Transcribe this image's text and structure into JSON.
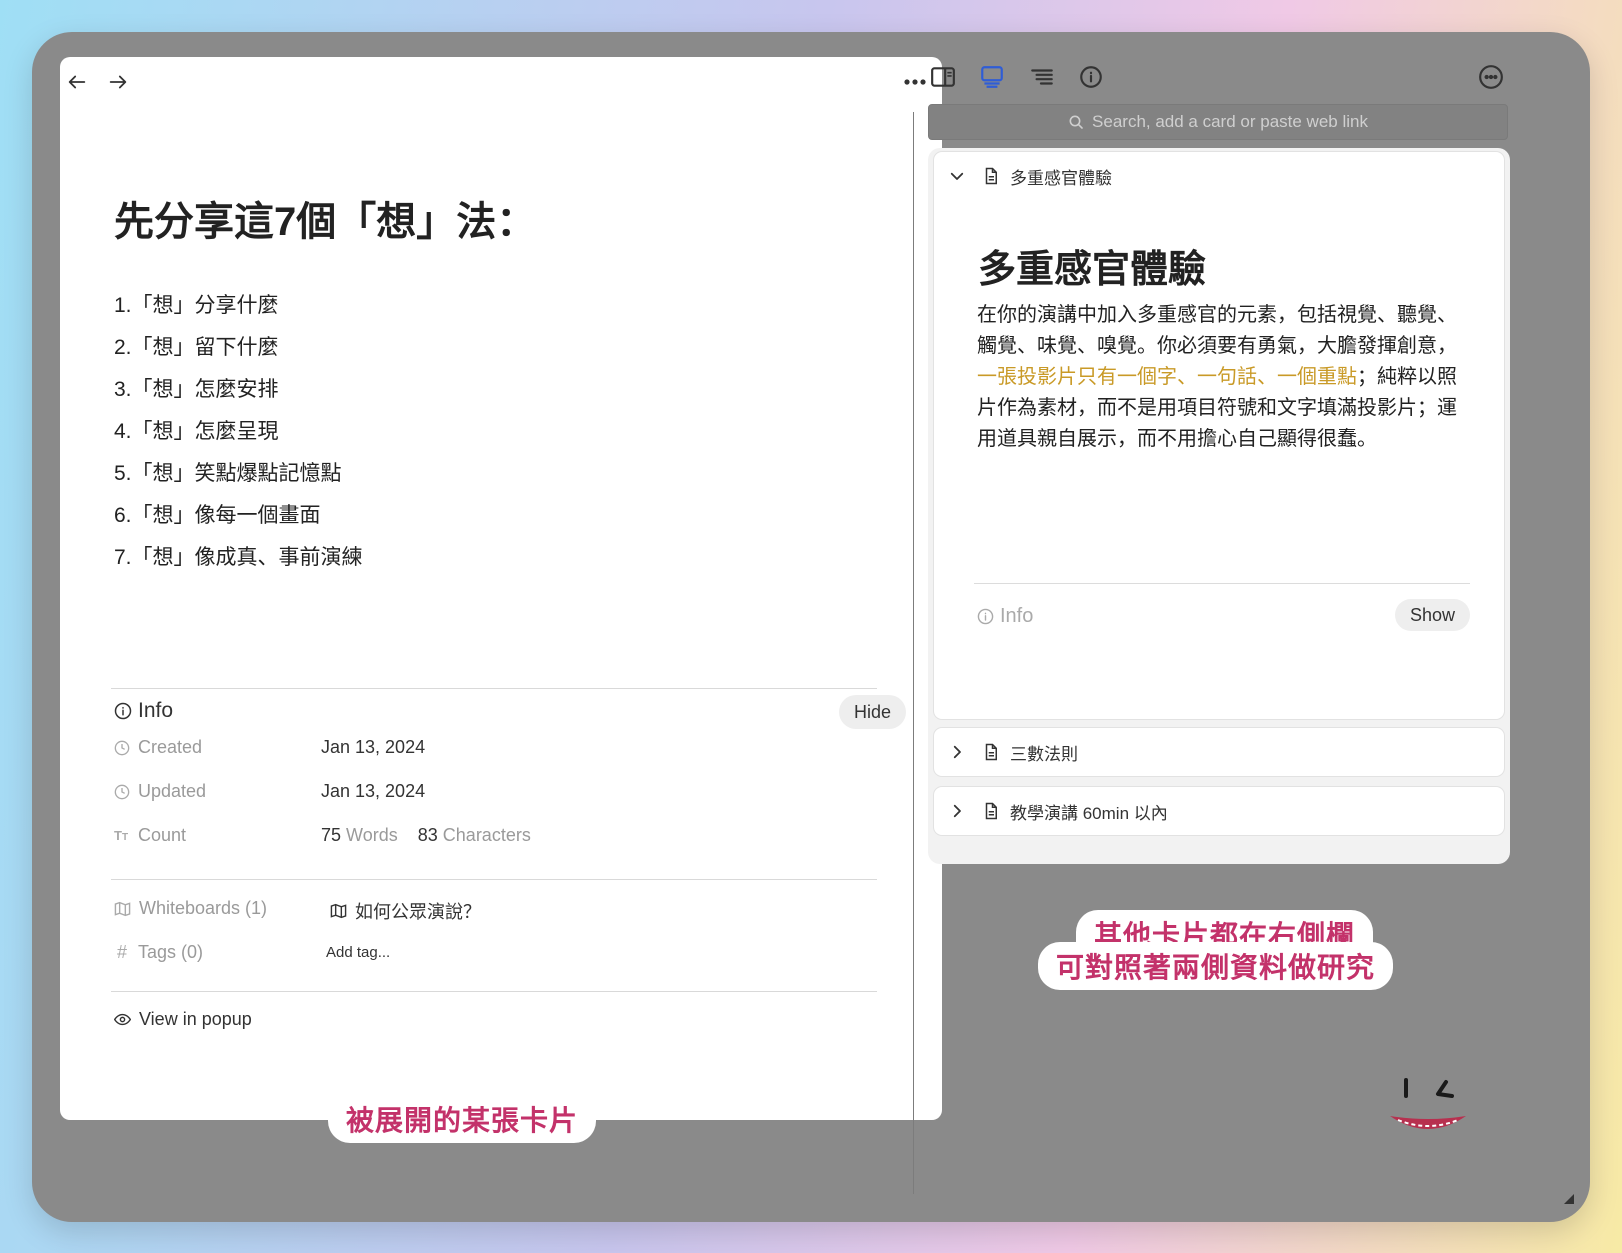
{
  "main_card": {
    "title": "先分享這7個「想」法：",
    "items": [
      "1.「想」分享什麼",
      "2.「想」留下什麼",
      "3.「想」怎麼安排",
      "4.「想」怎麼呈現",
      "5.「想」笑點爆點記憶點",
      "6.「想」像每一個畫面",
      "7.「想」像成真、事前演練"
    ],
    "info_label": "Info",
    "hide_button": "Hide",
    "meta": {
      "created_label": "Created",
      "created_value": "Jan 13, 2024",
      "updated_label": "Updated",
      "updated_value": "Jan 13, 2024",
      "count_label": "Count",
      "words_count": "75",
      "words_label": "Words",
      "chars_count": "83",
      "chars_label": "Characters",
      "whiteboards_label": "Whiteboards (1)",
      "whiteboard_name": "如何公眾演說？",
      "tags_label": "Tags (0)",
      "add_tag_placeholder": "Add tag...",
      "view_in_popup": "View in popup"
    }
  },
  "sidebar": {
    "search_placeholder": "Search, add a card or paste web link",
    "expanded_card": {
      "header": "多重感官體驗",
      "title": "多重感官體驗",
      "body_before": "在你的演講中加入多重感官的元素，包括視覺、聽覺、觸覺、味覺、嗅覺。你必須要有勇氣，大膽發揮創意，",
      "body_highlight": "一張投影片只有一個字、一句話、一個重點",
      "body_after": "；純粹以照片作為素材，而不是用項目符號和文字填滿投影片；運用道具親自展示，而不用擔心自己顯得很蠢。",
      "info_label": "Info",
      "show_button": "Show"
    },
    "collapsed_cards": [
      "三數法則",
      "教學演講 60min 以內"
    ]
  },
  "annotations": {
    "left_caption": "被展開的某張卡片",
    "right_caption_line1": "其他卡片都在右側欄",
    "right_caption_line2": "可對照著兩側資料做研究"
  },
  "colors": {
    "highlight": "#c99a27",
    "caption_text": "#c3326a",
    "window_bg": "#8a8a8a"
  },
  "icons": [
    "arrow-left-icon",
    "arrow-right-icon",
    "more-horizontal-icon",
    "sidebar-layout-icon",
    "cards-view-icon",
    "outline-list-icon",
    "info-circle-icon",
    "more-circle-icon",
    "search-icon",
    "chevron-down-icon",
    "chevron-right-icon",
    "document-icon",
    "clock-icon",
    "text-size-icon",
    "whiteboard-icon",
    "hash-icon",
    "eye-icon"
  ]
}
